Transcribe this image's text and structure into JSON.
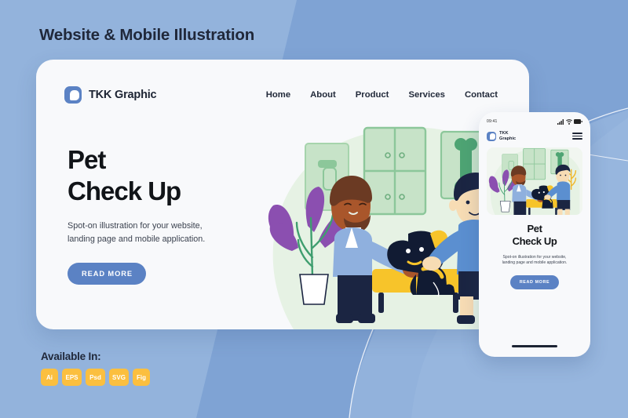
{
  "poster": {
    "title": "Website & Mobile Illustration",
    "bg_color_left": "#93B3DC",
    "bg_color_right": "#7FA3D4",
    "accent_blue": "#5B82C4",
    "badge_color": "#FBBF3F"
  },
  "desktop": {
    "brand": {
      "name": "TKK Graphic",
      "logo_icon": "logo-mark-icon"
    },
    "nav_links": [
      {
        "label": "Home"
      },
      {
        "label": "About"
      },
      {
        "label": "Product"
      },
      {
        "label": "Services"
      },
      {
        "label": "Contact"
      }
    ],
    "hero": {
      "title": "Pet\nCheck Up",
      "subtitle": "Spot-on illustration for your website,\nlanding page and mobile application.",
      "cta_label": "READ MORE"
    }
  },
  "phone": {
    "status": {
      "time": "09:41",
      "icons": [
        "signal-icon",
        "wifi-icon",
        "battery-icon"
      ]
    },
    "brand": {
      "name": "TKK\nGraphic",
      "logo_icon": "logo-mark-icon",
      "menu_icon": "hamburger-menu-icon"
    },
    "hero": {
      "title": "Pet\nCheck Up",
      "subtitle": "Spot-on illustration for your website,\nlanding page and mobile application.",
      "cta_label": "READ MORE"
    }
  },
  "available": {
    "label": "Available In:",
    "formats": [
      {
        "label": "Ai"
      },
      {
        "label": "EPS"
      },
      {
        "label": "Psd"
      },
      {
        "label": "SVG"
      },
      {
        "label": "Fig"
      }
    ]
  },
  "illustration": {
    "scene_name": "pet-check-up-vet-scene",
    "colors": {
      "wall": "#EAF4E8",
      "cabinet": "#BEE0C0",
      "cabinet_line": "#8CC79A",
      "vet_skin": "#A9562B",
      "vet_hair": "#6B3A23",
      "vet_coat": "#8FB0DE",
      "navy": "#1B2542",
      "boy_skin": "#F7DCB4",
      "boy_shirt": "#5B8FD0",
      "dog_body": "#111B33",
      "collar": "#F7C42A",
      "bench": "#F7C42A",
      "plant_purple": "#8B4FB0",
      "plant_green": "#3F9E6F",
      "plant_yellow": "#F0B72C",
      "pot": "#FFFFFF"
    }
  }
}
